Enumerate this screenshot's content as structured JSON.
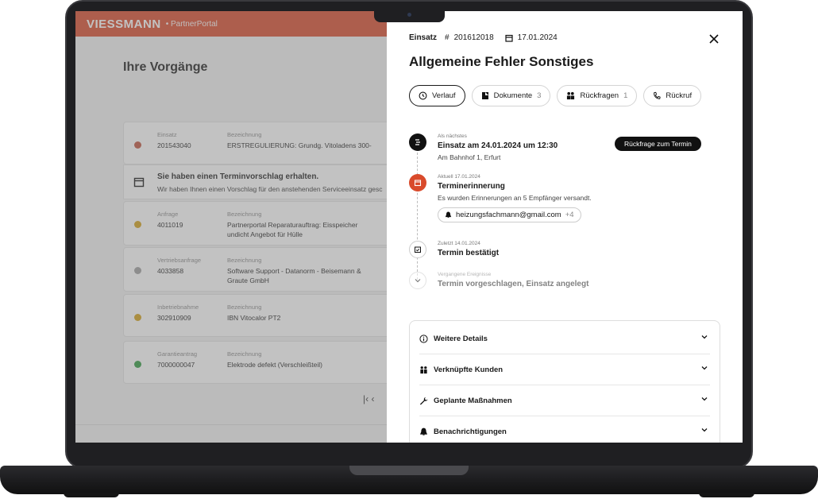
{
  "left": {
    "brand": "VIESSMANN",
    "portal": "• PartnerPortal",
    "page_title": "Ihre Vorgänge",
    "items": [
      {
        "type_label": "Einsatz",
        "number": "201543040",
        "desc_label": "Bezeichnung",
        "desc": "ERSTREGULIERUNG: Grundg. Vitoladens 300-",
        "color": "#c0533c"
      },
      {
        "type_label": "Anfrage",
        "number": "4011019",
        "desc_label": "Bezeichnung",
        "desc": "Partnerportal Reparaturauftrag: Eisspeicher undicht Angebot für Hülle",
        "color": "#d4a017"
      },
      {
        "type_label": "Vertriebsanfrage",
        "number": "4033858",
        "desc_label": "Bezeichnung",
        "desc": "Software Support - Datanorm - Beisemann & Graute GmbH",
        "color": "#9e9e9e"
      },
      {
        "type_label": "Inbetriebnahme",
        "number": "302910909",
        "desc_label": "Bezeichnung",
        "desc": "IBN Vitocalor PT2",
        "color": "#d4a017"
      },
      {
        "type_label": "Garantieantrag",
        "number": "7000000047",
        "desc_label": "Bezeichnung",
        "desc": "Elektrode defekt (Verschleißteil)",
        "color": "#2e9c3e"
      }
    ],
    "notice_title": "Sie haben einen Terminvorschlag erhalten.",
    "notice_text": "Wir haben Ihnen einen Vorschlag für den anstehenden Serviceeinsatz gesc",
    "pager": "|‹  ‹"
  },
  "panel": {
    "type": "Einsatz",
    "hash": "#",
    "number": "201612018",
    "date": "17.01.2024",
    "title": "Allgemeine Fehler Sonstiges",
    "tabs": [
      {
        "label": "Verlauf",
        "count": "",
        "icon": "history-icon"
      },
      {
        "label": "Dokumente",
        "count": "3",
        "icon": "document-icon"
      },
      {
        "label": "Rückfragen",
        "count": "1",
        "icon": "people-icon"
      },
      {
        "label": "Rückruf",
        "count": "",
        "icon": "phone-icon"
      }
    ],
    "events": [
      {
        "small": "Als nächstes",
        "main": "Einsatz am 24.01.2024 um 12:30",
        "sub": "Am Bahnhof 1, Erfurt"
      },
      {
        "small": "Aktuell  17.01.2024",
        "main": "Terminerinnerung",
        "sub": "Es wurden Erinnerungen an 5 Empfänger versandt."
      },
      {
        "small": "Zuletzt  14.01.2024",
        "main": "Termin bestätigt",
        "sub": ""
      },
      {
        "small": "Vergangene Ereignisse",
        "main": "Termin vorgeschlagen, Einsatz angelegt",
        "sub": ""
      }
    ],
    "action_button": "Rückfrage zum Termin",
    "chip_email": "heizungsfachmann@gmail.com",
    "chip_more": "+4",
    "accordion": [
      {
        "label": "Weitere Details",
        "icon": "info-icon"
      },
      {
        "label": "Verknüpfte Kunden",
        "icon": "customers-icon"
      },
      {
        "label": "Geplante Maßnahmen",
        "icon": "wrench-icon"
      },
      {
        "label": "Benachrichtigungen",
        "icon": "bell-icon"
      }
    ],
    "colors": {
      "accent": "#d94a2b",
      "dark": "#111111"
    }
  }
}
